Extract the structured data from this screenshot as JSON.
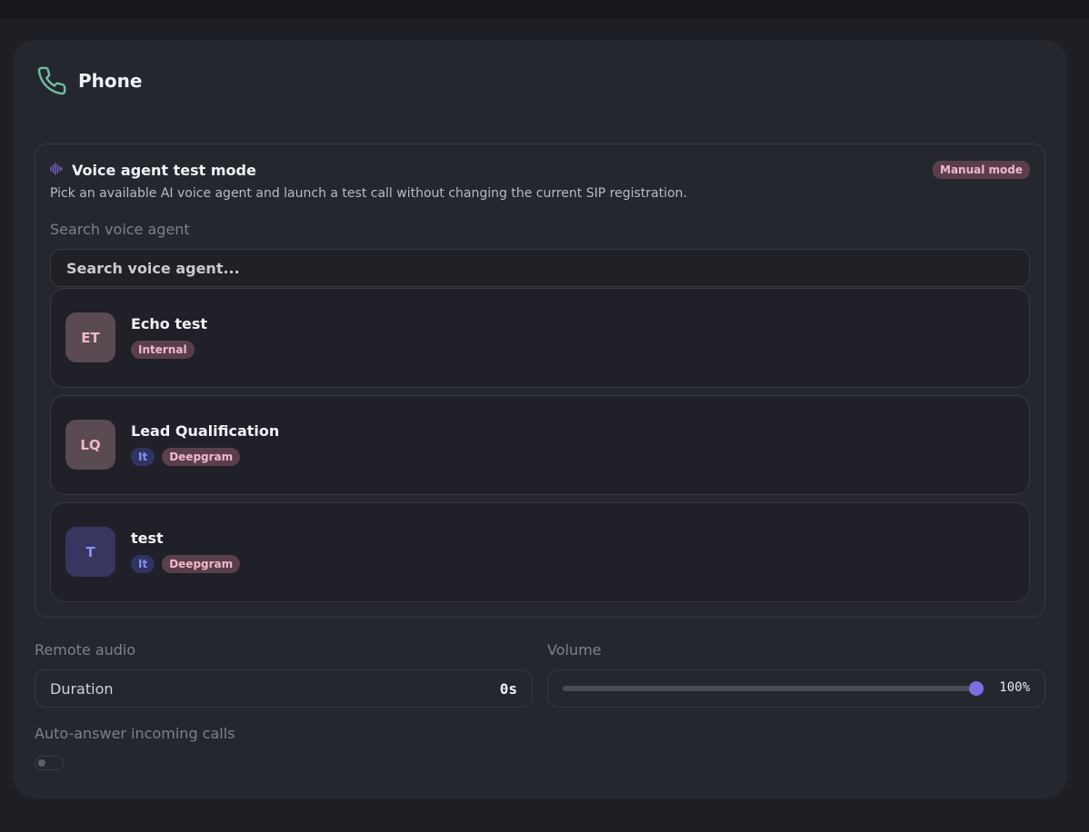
{
  "card": {
    "title": "Phone",
    "icon": "phone-icon",
    "accent_color": "#6fbfa5"
  },
  "agent_panel": {
    "title": "Voice agent test mode",
    "icon": "waveform-icon",
    "badge": "Manual mode",
    "description": "Pick an available AI voice agent and launch a test call without changing the current SIP registration.",
    "search_label": "Search voice agent",
    "search_placeholder": "Search voice agent...",
    "agents": [
      {
        "initials": "ET",
        "name": "Echo test",
        "tags": [
          "Internal"
        ]
      },
      {
        "initials": "LQ",
        "name": "Lead Qualification",
        "tags": [
          "It",
          "Deepgram"
        ]
      },
      {
        "initials": "T",
        "name": "test",
        "tags": [
          "It",
          "Deepgram"
        ]
      }
    ]
  },
  "remote_audio": {
    "label": "Remote audio",
    "duration_label": "Duration",
    "duration_value": "0s"
  },
  "volume": {
    "label": "Volume",
    "value_text": "100%",
    "level": 1.0
  },
  "auto_answer": {
    "label": "Auto-answer incoming calls",
    "enabled": false
  }
}
